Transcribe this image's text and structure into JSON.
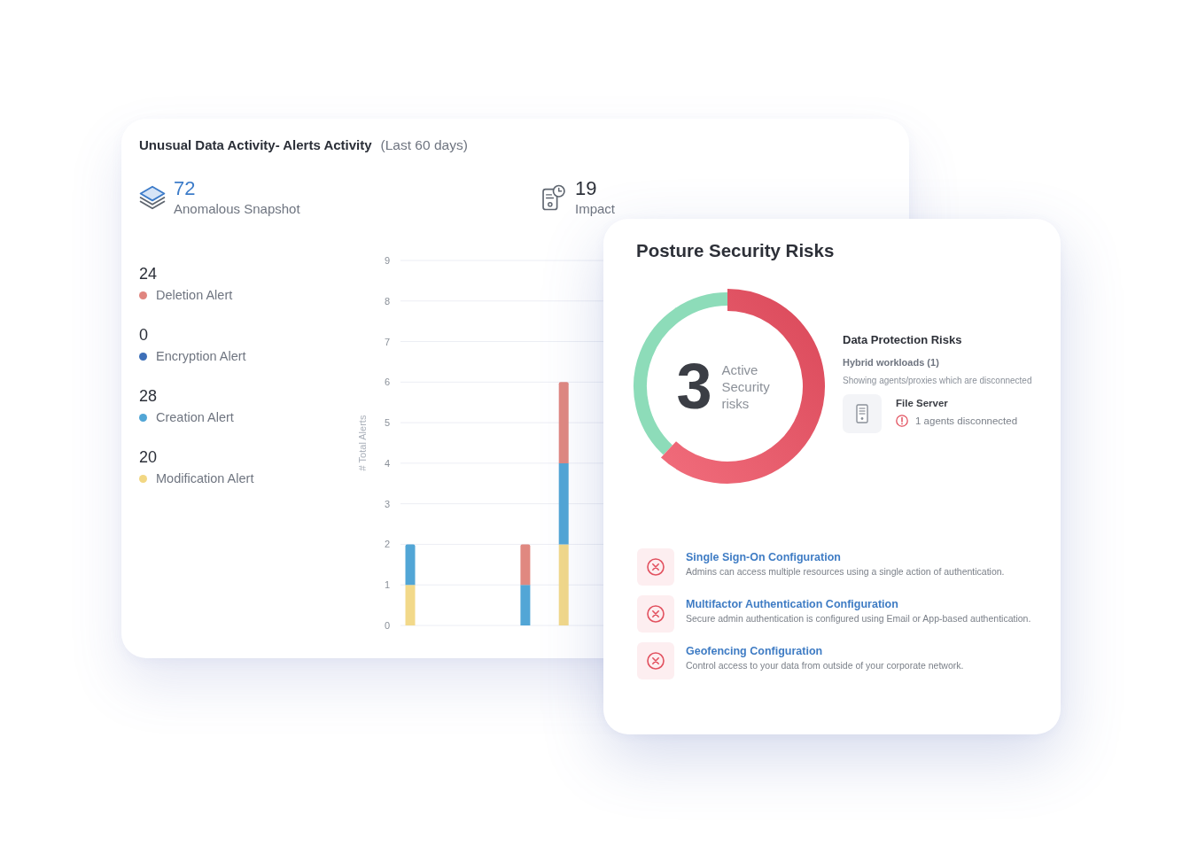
{
  "alerts_card": {
    "title": "Unusual Data Activity- Alerts Activity",
    "period": "(Last 60 days)",
    "stats": [
      {
        "kind": "snapshot",
        "value": "72",
        "label": "Anomalous Snapshot"
      },
      {
        "kind": "resource",
        "value": "19",
        "label": "Impact"
      }
    ],
    "alerts": [
      {
        "count": "24",
        "label": "Deletion Alert",
        "color": "#e0857f"
      },
      {
        "count": "0",
        "label": "Encryption Alert",
        "color": "#3d6fb8"
      },
      {
        "count": "28",
        "label": "Creation Alert",
        "color": "#52a6d6"
      },
      {
        "count": "20",
        "label": "Modification Alert",
        "color": "#f2d783"
      }
    ],
    "chart_data": {
      "type": "bar",
      "stacked": true,
      "grid": true,
      "ylabel": "# Total Alerts",
      "ylim": [
        0,
        9
      ],
      "yticks": [
        0,
        1,
        2,
        3,
        4,
        5,
        6,
        7,
        8,
        9
      ],
      "series": [
        {
          "color": "#f2d98a",
          "values": [
            1,
            0,
            0,
            0,
            2
          ]
        },
        {
          "color": "#52a6d6",
          "values": [
            1,
            0,
            0,
            1,
            2
          ]
        },
        {
          "color": "#e08880",
          "values": [
            0,
            0,
            0,
            1,
            2
          ]
        }
      ]
    }
  },
  "posture_card": {
    "title": "Posture Security Risks",
    "count": "3",
    "count_label": "Active Security risks",
    "data_protection": {
      "title": "Data Protection Risks",
      "subtitle": "Hybrid workloads (1)",
      "note": "Showing agents/proxies which are disconnected",
      "resources": [
        {
          "name": "File Server",
          "status": "1 agents disconnected"
        }
      ]
    },
    "checks": [
      {
        "title": "Single Sign-On Configuration",
        "description": "Admins can access multiple resources using a single action of authentication.",
        "passed": false
      },
      {
        "title": "Multifactor Authentication Configuration",
        "description": "Secure admin authentication is configured using Email or App-based authentication.",
        "passed": false
      },
      {
        "title": "Geofencing Configuration",
        "description": "Control access to your data from outside of your corporate network.",
        "passed": false
      }
    ]
  }
}
